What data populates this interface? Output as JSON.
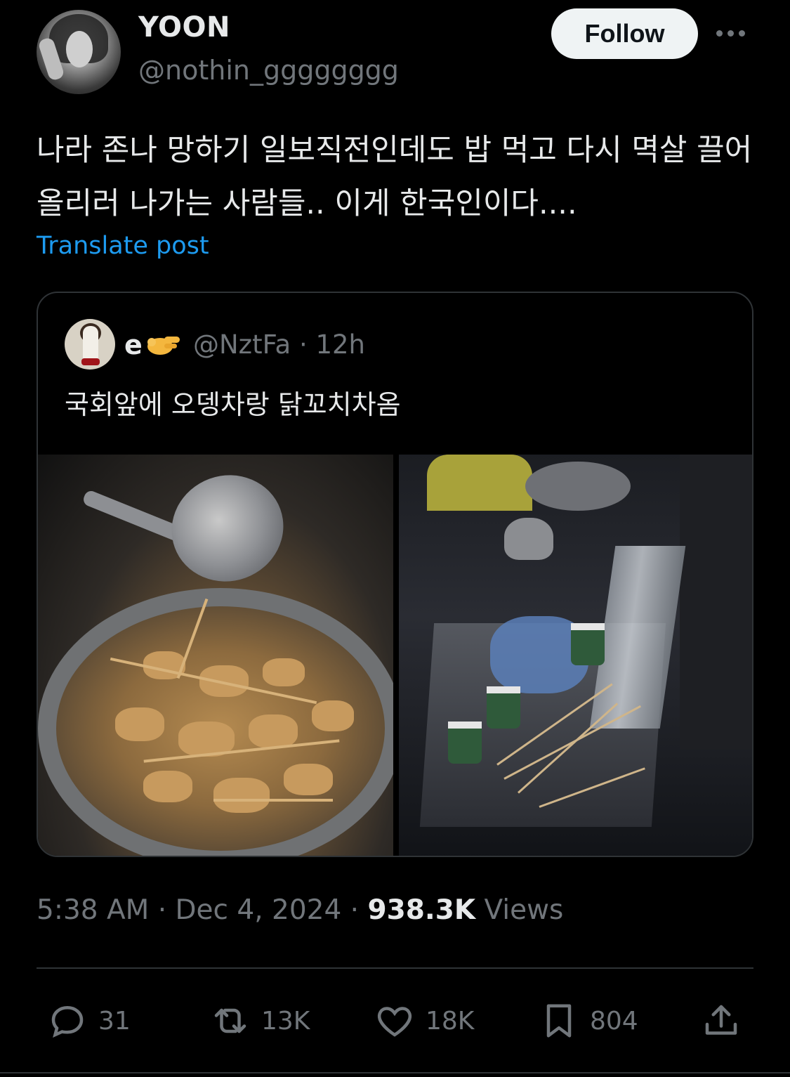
{
  "author": {
    "name": "YOON",
    "handle": "@nothin_gggggggg"
  },
  "follow_label": "Follow",
  "post": {
    "text": "나라 존나 망하기 일보직전인데도 밥 먹고 다시 멱살 끌어올리러 나가는 사람들.. 이게 한국인이다....",
    "translate_label": "Translate post"
  },
  "quote": {
    "name": "e",
    "name_emoji": "🫰",
    "handle": "@NztFa",
    "separator": "·",
    "time": "12h",
    "text": "국회앞에 오뎅차랑 닭꼬치차옴"
  },
  "meta": {
    "time": "5:38 AM",
    "dot1": "·",
    "date": "Dec 4, 2024",
    "dot2": "·",
    "views_count": "938.3K",
    "views_label": "Views"
  },
  "actions": {
    "replies": "31",
    "reposts": "13K",
    "likes": "18K",
    "bookmarks": "804"
  },
  "colors": {
    "background": "#000000",
    "text_primary": "#e7e9ea",
    "text_secondary": "#71767b",
    "link": "#1d9bf0",
    "border": "#2f3336",
    "follow_bg": "#eff3f4"
  }
}
